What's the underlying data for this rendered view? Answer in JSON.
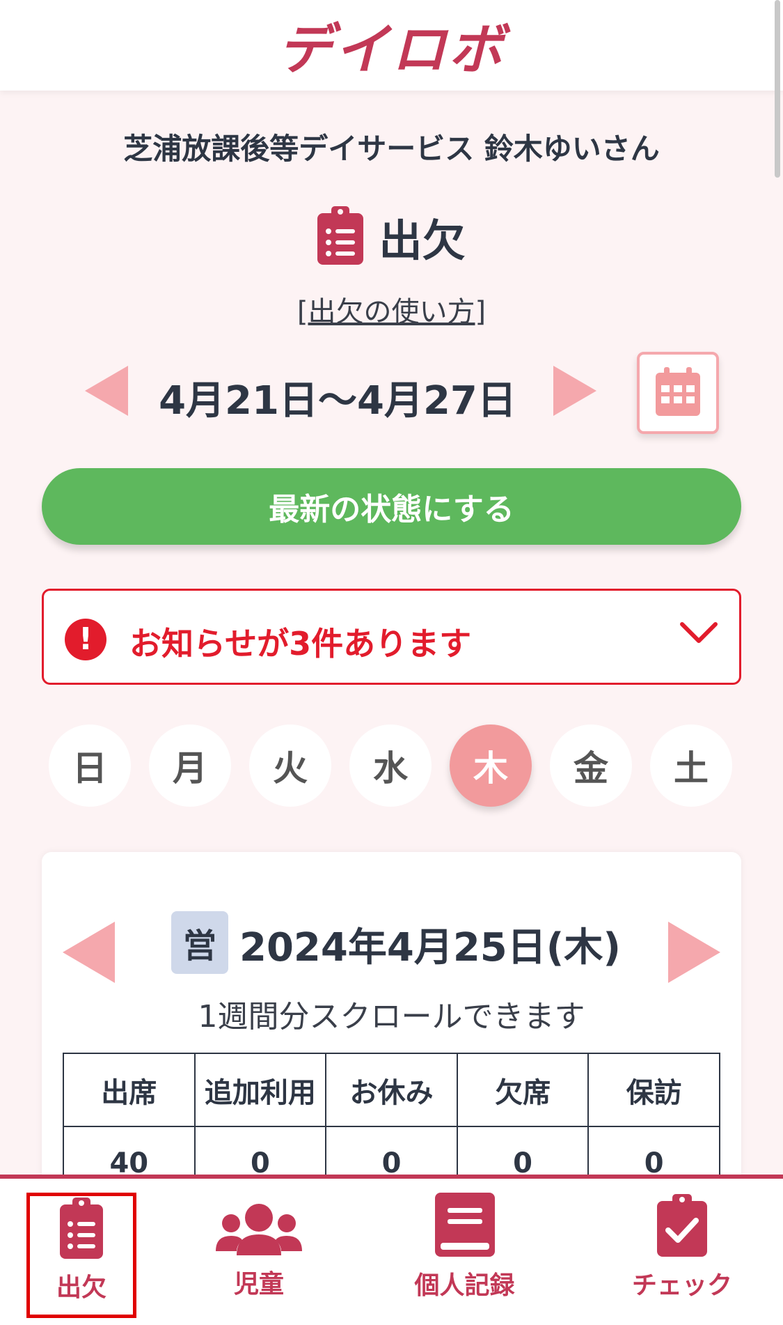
{
  "app": {
    "title": "デイロボ"
  },
  "facility": {
    "line": "芝浦放課後等デイサービス 鈴木ゆいさん"
  },
  "page": {
    "title": "出欠",
    "howto_open": "[",
    "howto_link": "出欠の使い方",
    "howto_close": "]"
  },
  "week": {
    "range": "4月21日〜4月27日"
  },
  "refresh": {
    "label": "最新の状態にする"
  },
  "notice": {
    "icon_text": "!",
    "text": "お知らせが3件あります"
  },
  "days": [
    {
      "label": "日",
      "active": false
    },
    {
      "label": "月",
      "active": false
    },
    {
      "label": "火",
      "active": false
    },
    {
      "label": "水",
      "active": false
    },
    {
      "label": "木",
      "active": true
    },
    {
      "label": "金",
      "active": false
    },
    {
      "label": "土",
      "active": false
    }
  ],
  "day_card": {
    "badge": "営",
    "date": "2024年4月25日(木)",
    "hint": "1週間分スクロールできます",
    "table": {
      "headers": [
        "出席",
        "追加利用",
        "お休み",
        "欠席",
        "保訪"
      ],
      "values": [
        "40",
        "0",
        "0",
        "0",
        "0"
      ]
    }
  },
  "bottom_nav": {
    "items": [
      {
        "label": "出欠",
        "icon": "clipboard-list-icon",
        "selected": true
      },
      {
        "label": "児童",
        "icon": "users-icon",
        "selected": false
      },
      {
        "label": "個人記録",
        "icon": "book-icon",
        "selected": false
      },
      {
        "label": "チェック",
        "icon": "clipboard-check-icon",
        "selected": false
      }
    ]
  },
  "colors": {
    "brand": "#c23856",
    "accent_pink": "#f5a8ad",
    "green": "#5eb85d",
    "alert_red": "#e21c2c",
    "background": "#fdf3f4"
  }
}
